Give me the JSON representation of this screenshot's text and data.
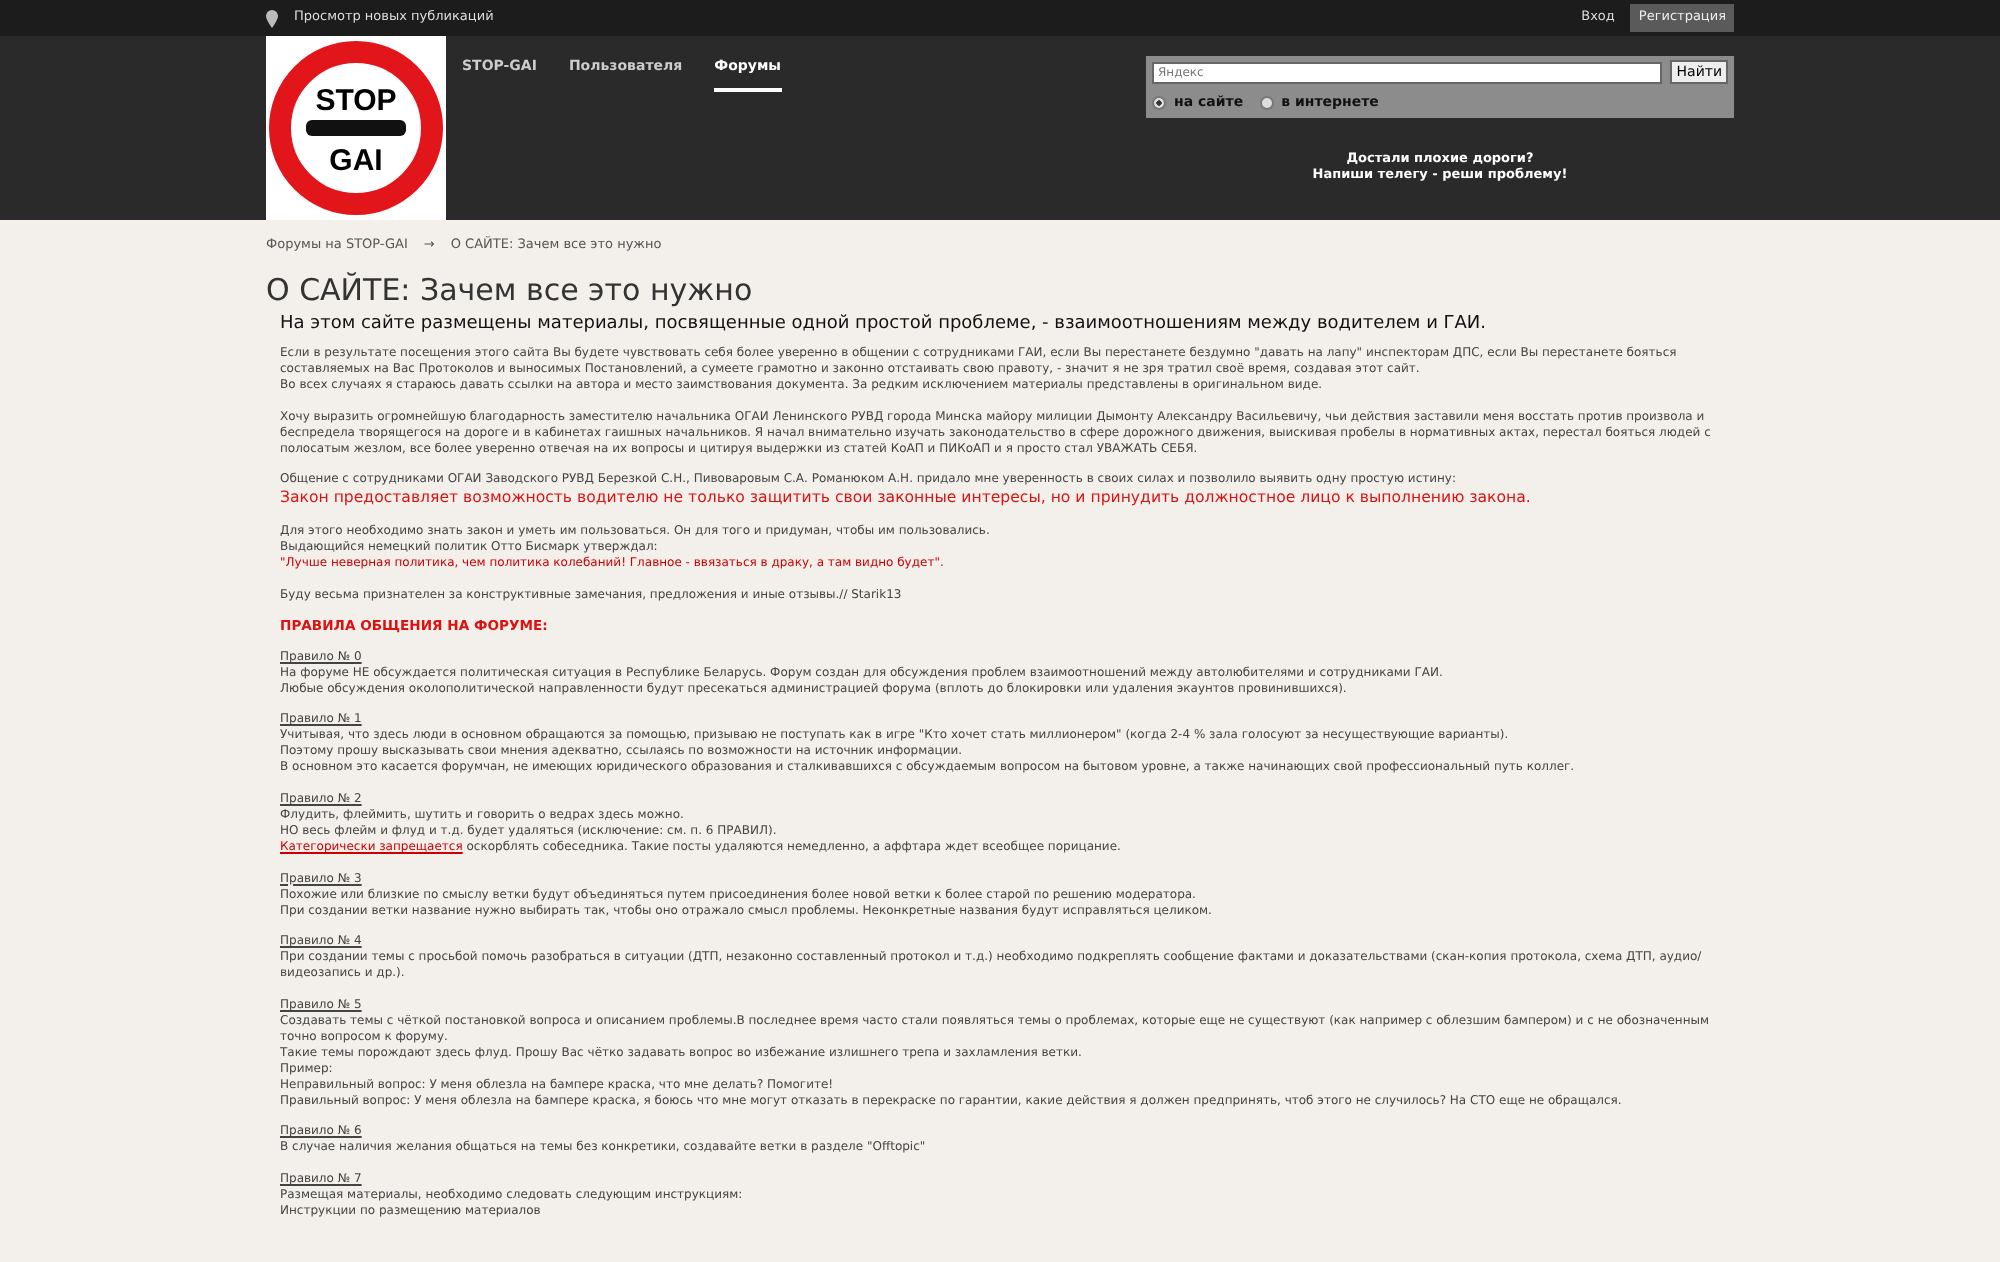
{
  "top_bar": {
    "news_link": "Просмотр новых публикаций",
    "login": "Вход",
    "register": "Регистрация"
  },
  "logo": {
    "line1": "STOP",
    "line2": "GAI"
  },
  "nav": [
    {
      "label": "STOP-GAI",
      "selected": false
    },
    {
      "label": "Пользователя",
      "selected": false
    },
    {
      "label": "Форумы",
      "selected": true
    }
  ],
  "search": {
    "placeholder": "Яндекс",
    "button": "Найти",
    "options": [
      {
        "label": "на сайте",
        "selected": true
      },
      {
        "label": "в интернете",
        "selected": false
      }
    ]
  },
  "promo": [
    "Достали плохие дороги?",
    "Напиши телегу - реши проблему!"
  ],
  "breadcrumb": {
    "link": "Форумы на STOP-GAI",
    "separator": "→",
    "current": "О САЙТЕ: Зачем все это нужно"
  },
  "title": "О САЙТЕ: Зачем все это нужно",
  "lead": "На этом сайте размещены материалы, посвященные одной простой проблеме, - взаимоотношениям между водителем и ГАИ.",
  "paragraphs": [
    [
      {
        "kind": "text",
        "text": "Если в результате посещения этого сайта Вы будете чувствовать себя более уверенно в общении с сотрудниками ГАИ, если Вы перестанете бездумно \"давать на лапу\" инспекторам ДПС, если Вы перестанете бояться составляемых на Вас Протоколов и выносимых Постановлений, а сумеете грамотно и законно отстаивать свою правоту, - значит я не зря тратил своё время, создавая этот сайт."
      },
      {
        "kind": "text",
        "text": "Во всех случаях я стараюсь давать ссылки на автора и место заимствования документа. За редким исключением материалы представлены в оригинальном виде."
      }
    ],
    [
      {
        "kind": "text",
        "text": "Хочу выразить огромнейшую благодарность заместителю начальника ОГАИ Ленинского РУВД города Минска майору милиции Дымонту Александру Васильевичу, чьи действия заставили меня восстать против произвола и беспредела творящегося на дороге и в кабинетах гаишных начальников. Я начал внимательно изучать законодательство в сфере дорожного движения, выискивая пробелы в нормативных актах, перестал бояться людей с полосатым жезлом, все более уверенно отвечая на их вопросы и цитируя выдержки из статей КоАП и ПИКоАП и я просто стал УВАЖАТЬ СЕБЯ."
      }
    ],
    [
      {
        "kind": "text",
        "text": "Общение с сотрудниками ОГАИ Заводского РУВД Березкой С.Н., Пивоваровым С.А. Романюком А.Н. придало мне уверенность в своих силах и позволило выявить одну простую истину:"
      },
      {
        "kind": "alert",
        "text": "Закон предоставляет возможность водителю не только защитить свои законные интересы, но и принудить должностное лицо к выполнению закона."
      }
    ],
    [
      {
        "kind": "text",
        "text": "Для этого необходимо знать закон и уметь им пользоваться. Он для того и придуман, чтобы им пользовались."
      },
      {
        "kind": "text",
        "text": "Выдающийся немецкий политик Отто Бисмарк утверждал:"
      },
      {
        "kind": "quote",
        "text": "\"Лучше неверная политика, чем политика колебаний! Главное - ввязаться в драку, а там видно будет\"."
      }
    ],
    [
      {
        "kind": "text",
        "text": "Буду весьма признателен за конструктивные замечания, предложения и иные отзывы.// Starik13"
      }
    ],
    [
      {
        "kind": "heading",
        "text": "ПРАВИЛА ОБЩЕНИЯ НА ФОРУМЕ:"
      }
    ],
    [
      {
        "kind": "rule",
        "text": "Правило № 0"
      },
      {
        "kind": "text",
        "text": "На форуме НЕ обсуждается политическая ситуация в Республике Беларусь. Форум создан для обсуждения проблем взаимоотношений между автолюбителями и сотрудниками ГАИ."
      },
      {
        "kind": "text",
        "text": "Любые обсуждения околополитической направленности будут пресекаться администрацией форума (вплоть до блокировки или удаления экаунтов провинившихся)."
      }
    ],
    [
      {
        "kind": "rule",
        "text": "Правило № 1"
      },
      {
        "kind": "text",
        "text": "Учитывая, что здесь люди в основном обращаются за помощью, призываю не поступать как в игре \"Кто хочет стать миллионером\" (когда 2-4 % зала голосуют за несуществующие варианты)."
      },
      {
        "kind": "text",
        "text": "Поэтому прошу высказывать свои мнения адекватно, ссылаясь по возможности на источник информации."
      },
      {
        "kind": "text",
        "text": "В основном это касается форумчан, не имеющих юридического образования и сталкивавшихся с обсуждаемым вопросом на бытовом уровне, а также начинающих свой профессиональный путь коллег."
      }
    ],
    [
      {
        "kind": "rule",
        "text": "Правило № 2"
      },
      {
        "kind": "text",
        "text": "Флудить, флеймить, шутить и говорить о ведрах здесь можно."
      },
      {
        "kind": "text",
        "text": "НО весь флейм и флуд и т.д. будет удаляться (исключение: см. п. 6 ПРАВИЛ)."
      },
      {
        "kind": "link",
        "link": "Категорически запрещается",
        "text": " оскорблять собеседника. Такие посты удаляются немедленно, а аффтара ждет всеобщее порицание."
      }
    ],
    [
      {
        "kind": "rule",
        "text": "Правило № 3"
      },
      {
        "kind": "text",
        "text": "Похожие или близкие по смыслу ветки будут объединяться путем присоединения более новой ветки к более старой по решению модератора."
      },
      {
        "kind": "text",
        "text": "При создании ветки название нужно выбирать так, чтобы оно отражало смысл проблемы. Неконкретные названия будут исправляться целиком."
      }
    ],
    [
      {
        "kind": "rule",
        "text": "Правило № 4"
      },
      {
        "kind": "text",
        "text": "При создании темы с просьбой помочь разобраться в ситуации (ДТП, незаконно составленный протокол и т.д.) необходимо подкреплять сообщение фактами и доказательствами (скан-копия протокола, схема ДТП, аудио/видеозапись и др.)."
      }
    ],
    [
      {
        "kind": "rule",
        "text": "Правило № 5"
      },
      {
        "kind": "text",
        "text": "Создавать темы с чёткой постановкой вопроса и описанием проблемы.В последнее время часто стали появляться темы о проблемах, которые еще не существуют (как например с облезшим бампером) и с не обозначенным точно вопросом к форуму."
      },
      {
        "kind": "text",
        "text": "Такие темы порождают здесь флуд. Прошу Вас чётко задавать вопрос во избежание излишнего трепа и захламления ветки."
      },
      {
        "kind": "text",
        "text": "Пример:"
      },
      {
        "kind": "text",
        "text": "Неправильный вопрос: У меня облезла на бампере краска, что мне делать? Помогите!"
      },
      {
        "kind": "text",
        "text": "Правильный вопрос: У меня облезла на бампере краска, я боюсь что мне могут отказать в перекраске по гарантии, какие действия я должен предпринять, чтоб этого не случилось? На СТО еще не обращался."
      }
    ],
    [
      {
        "kind": "rule",
        "text": "Правило № 6"
      },
      {
        "kind": "text",
        "text": "В случае наличия желания общаться на темы без конкретики, создавайте ветки в разделе \"Offtopic\""
      }
    ],
    [
      {
        "kind": "rule",
        "text": "Правило № 7"
      },
      {
        "kind": "text",
        "text": "Размещая материалы, необходимо следовать следующим инструкциям:"
      },
      {
        "kind": "text",
        "text": "Инструкции по размещению материалов"
      }
    ]
  ]
}
